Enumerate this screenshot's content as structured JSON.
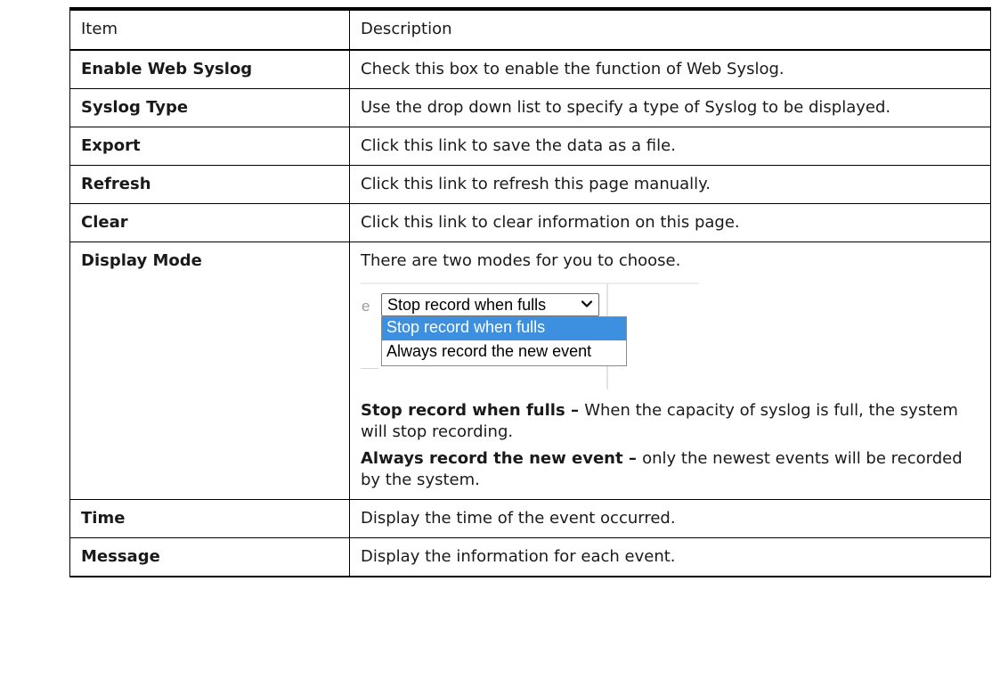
{
  "table": {
    "headers": [
      "Item",
      "Description"
    ],
    "rows": [
      {
        "item": "Enable Web Syslog",
        "description": "Check this box to enable the function of Web Syslog."
      },
      {
        "item": "Syslog Type",
        "description": "Use the drop down list to specify a type of Syslog to be displayed."
      },
      {
        "item": "Export",
        "description": "Click this link to save the data as a file."
      },
      {
        "item": "Refresh",
        "description": "Click this link to refresh this page manually."
      },
      {
        "item": "Clear",
        "description": "Click this link to clear information on this page."
      },
      {
        "item": "Display Mode",
        "intro": "There are two modes for you to choose.",
        "dropdown": {
          "lead_fragment": "e",
          "selected_value": "Stop record when fulls",
          "options": [
            "Stop record when fulls",
            "Always record the new event"
          ],
          "highlight_color": "#3d8fe0"
        },
        "details": [
          {
            "term": "Stop record when fulls",
            "separator": " – ",
            "text": "When the capacity of syslog is full, the system will stop recording."
          },
          {
            "term": "Always record the new event",
            "separator": " – ",
            "text": "only the newest events will be recorded by the system."
          }
        ]
      },
      {
        "item": "Time",
        "description": "Display the time of the event occurred."
      },
      {
        "item": "Message",
        "description": "Display the information for each event."
      }
    ]
  }
}
